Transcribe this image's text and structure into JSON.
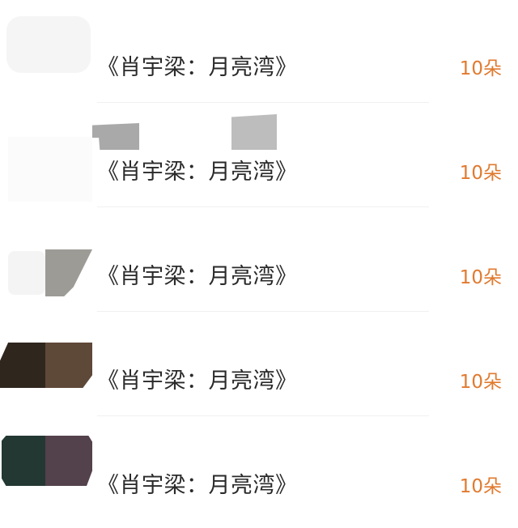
{
  "gifts": [
    {
      "title": "《肖宇梁：月亮湾》",
      "count": "10朵"
    },
    {
      "title": "《肖宇梁：月亮湾》",
      "count": "10朵"
    },
    {
      "title": "《肖宇梁：月亮湾》",
      "count": "10朵"
    },
    {
      "title": "《肖宇梁：月亮湾》",
      "count": "10朵"
    },
    {
      "title": "《肖宇梁：月亮湾》",
      "count": "10朵"
    }
  ],
  "colors": {
    "title_text": "#2a2a2a",
    "count_text": "#e07a2f",
    "divider": "#f0f0f0",
    "background": "#ffffff"
  }
}
